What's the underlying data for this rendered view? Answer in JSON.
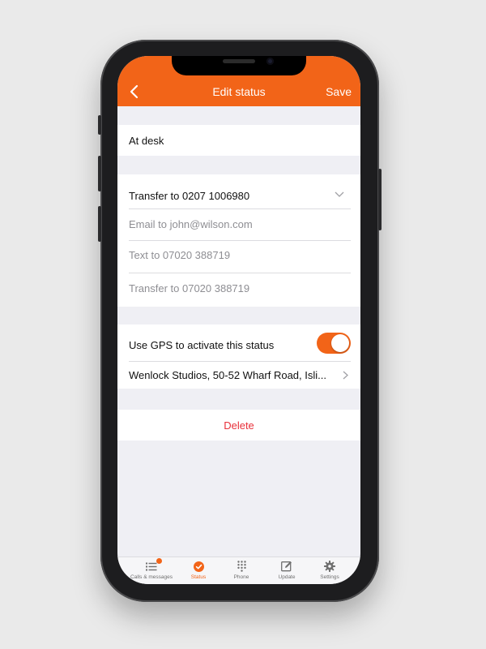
{
  "nav": {
    "title": "Edit status",
    "save": "Save"
  },
  "status_name": "At desk",
  "transfer": {
    "selected": "Transfer to 0207 1006980"
  },
  "actions": {
    "email": "Email to john@wilson.com",
    "text": "Text to 07020 388719",
    "transfer": "Transfer to 07020 388719"
  },
  "gps": {
    "label": "Use GPS to activate this status",
    "enabled": true
  },
  "location": "Wenlock Studios, 50-52 Wharf Road, Isli...",
  "delete": "Delete",
  "tabs": [
    {
      "label": "Calls & messages",
      "icon": "list-icon"
    },
    {
      "label": "Status",
      "icon": "check-circle-icon"
    },
    {
      "label": "Phone",
      "icon": "keypad-icon"
    },
    {
      "label": "Update",
      "icon": "edit-icon"
    },
    {
      "label": "Settings",
      "icon": "gear-icon"
    }
  ],
  "colors": {
    "accent": "#f26418",
    "destructive": "#e8303a",
    "background": "#efeff4"
  }
}
